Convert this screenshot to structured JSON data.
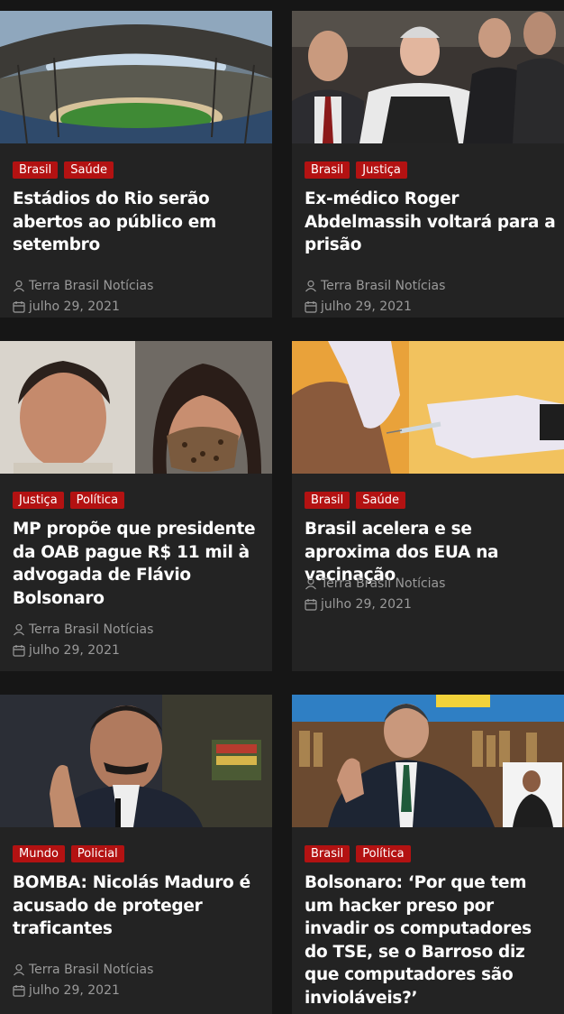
{
  "articles": [
    {
      "image": "maracana-stadium-photo",
      "tags": [
        "Brasil",
        "Saúde"
      ],
      "title": "Estádios do Rio serão abertos ao público em setembro",
      "author": "Terra Brasil Notícias",
      "date": "julho 29, 2021"
    },
    {
      "image": "roger-abdelmassih-photo",
      "tags": [
        "Brasil",
        "Justiça"
      ],
      "title": "Ex-médico Roger Abdelmassih voltará para a prisão",
      "author": "Terra Brasil Notícias",
      "date": "julho 29, 2021"
    },
    {
      "image": "oab-president-and-lawyer-photo",
      "tags": [
        "Justiça",
        "Política"
      ],
      "title": "MP propõe que presidente da OAB pague R$ 11 mil à advogada de Flávio Bolsonaro",
      "author": "Terra Brasil Notícias",
      "date": "julho 29, 2021"
    },
    {
      "image": "vaccination-photo",
      "tags": [
        "Brasil",
        "Saúde"
      ],
      "title": "Brasil acelera e se aproxima dos EUA na vacinação",
      "author": "Terra Brasil Notícias",
      "date": "julho 29, 2021"
    },
    {
      "image": "maduro-photo",
      "tags": [
        "Mundo",
        "Policial"
      ],
      "title": "BOMBA: Nicolás Maduro é acusado de proteger traficantes",
      "author": "Terra Brasil Notícias",
      "date": "julho 29, 2021"
    },
    {
      "image": "bolsonaro-speech-photo",
      "tags": [
        "Brasil",
        "Política"
      ],
      "title": "Bolsonaro: ‘Por que tem um hacker preso por invadir os computadores do TSE, se o Barroso diz que computadores são invioláveis?’",
      "author": "",
      "date": ""
    }
  ],
  "colors": {
    "background": "#161616",
    "card": "#232323",
    "tag": "#b31212",
    "title": "#ffffff",
    "meta": "#9a9a9a"
  },
  "icons": {
    "author": "user-icon",
    "date": "calendar-icon"
  }
}
